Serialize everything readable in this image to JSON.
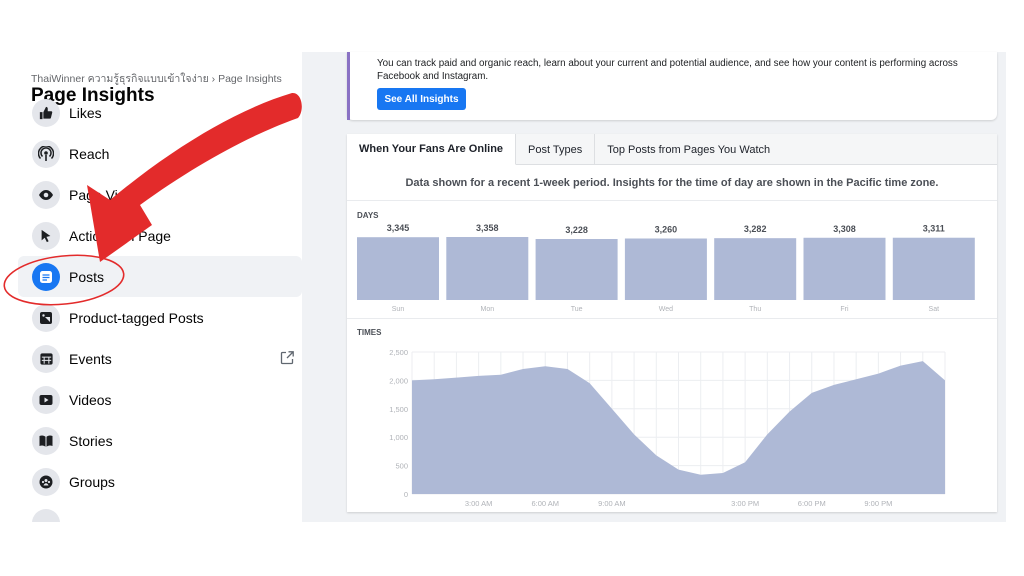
{
  "sidebar": {
    "breadcrumb": "ThaiWinner ความรู้ธุรกิจแบบเข้าใจง่าย › Page Insights",
    "title": "Page Insights",
    "items": [
      {
        "label": "Likes",
        "icon": "thumbs-up-icon"
      },
      {
        "label": "Reach",
        "icon": "broadcast-icon"
      },
      {
        "label": "Page Views",
        "icon": "eye-icon"
      },
      {
        "label": "Actions on Page",
        "icon": "cursor-icon"
      },
      {
        "label": "Posts",
        "icon": "posts-icon",
        "active": true
      },
      {
        "label": "Product-tagged Posts",
        "icon": "tag-icon"
      },
      {
        "label": "Events",
        "icon": "calendar-icon"
      },
      {
        "label": "Videos",
        "icon": "play-icon"
      },
      {
        "label": "Stories",
        "icon": "book-icon"
      },
      {
        "label": "Groups",
        "icon": "groups-icon"
      }
    ]
  },
  "banner": {
    "description": "You can track paid and organic reach, learn about your current and potential audience, and see how your content is performing across Facebook and Instagram.",
    "button_label": "See All Insights"
  },
  "tabs": [
    {
      "label": "When Your Fans Are Online",
      "active": true
    },
    {
      "label": "Post Types"
    },
    {
      "label": "Top Posts from Pages You Watch"
    }
  ],
  "notice": "Data shown for a recent 1-week period. Insights for the time of day are shown in the Pacific time zone.",
  "colors": {
    "accent": "#1877f2",
    "chart_fill": "#aeb9d6",
    "annotation": "#e32b2b",
    "banner_accent": "#8a72c4"
  },
  "chart_data": [
    {
      "type": "bar",
      "title": "DAYS",
      "categories": [
        "Sun",
        "Mon",
        "Tue",
        "Wed",
        "Thu",
        "Fri",
        "Sat"
      ],
      "values": [
        3345,
        3358,
        3228,
        3260,
        3282,
        3308,
        3311
      ],
      "value_labels": [
        "3,345",
        "3,358",
        "3,228",
        "3,260",
        "3,282",
        "3,308",
        "3,311"
      ]
    },
    {
      "type": "area",
      "title": "TIMES",
      "x_tick_labels": [
        "3:00 AM",
        "6:00 AM",
        "9:00 AM",
        "3:00 PM",
        "6:00 PM",
        "9:00 PM"
      ],
      "x_tick_hours": [
        3,
        6,
        9,
        15,
        18,
        21
      ],
      "x": [
        0,
        1,
        2,
        3,
        4,
        5,
        6,
        7,
        8,
        9,
        10,
        11,
        12,
        13,
        14,
        15,
        16,
        17,
        18,
        19,
        20,
        21,
        22,
        23
      ],
      "values": [
        2000,
        2020,
        2050,
        2080,
        2100,
        2200,
        2250,
        2200,
        1950,
        1500,
        1050,
        680,
        430,
        340,
        370,
        560,
        1050,
        1450,
        1780,
        1920,
        2020,
        2120,
        2260,
        2340,
        2000
      ],
      "x_end": 24,
      "y_ticks": [
        0,
        500,
        1000,
        1500,
        2000,
        2500
      ],
      "y_tick_labels": [
        "0",
        "500",
        "1,000",
        "1,500",
        "2,000",
        "2,500"
      ],
      "ylim": [
        0,
        2500
      ],
      "grid": true
    }
  ]
}
